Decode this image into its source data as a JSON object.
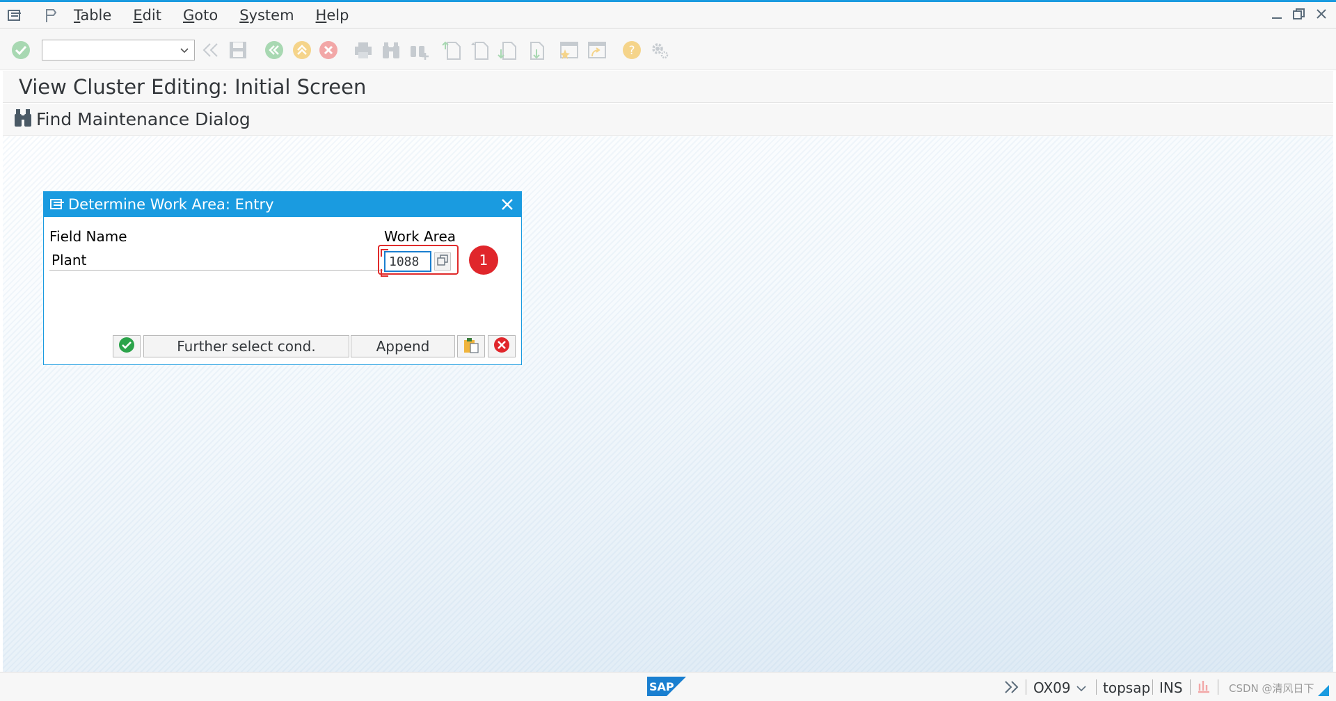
{
  "menu": {
    "items": [
      {
        "accel": "T",
        "rest": "able"
      },
      {
        "accel": "E",
        "rest": "dit"
      },
      {
        "accel": "G",
        "rest": "oto"
      },
      {
        "accel": "S",
        "rest": "ystem"
      },
      {
        "accel": "H",
        "rest": "elp"
      }
    ]
  },
  "toolbar": {
    "command_field_value": ""
  },
  "screen": {
    "title": "View Cluster Editing: Initial Screen",
    "app_button_label": "Find Maintenance Dialog"
  },
  "dialog": {
    "title": "Determine Work Area: Entry",
    "col_field_name": "Field Name",
    "col_work_area": "Work Area",
    "row_label": "Plant",
    "work_area_value": "1088",
    "annotation_number": "1",
    "buttons": {
      "further_select": "Further select cond.",
      "append": "Append"
    }
  },
  "statusbar": {
    "transaction": "OX09",
    "system": "topsap",
    "mode": "INS",
    "logo_text": "SAP",
    "watermark": "CSDN @清风日下"
  },
  "colors": {
    "accent": "#1a9be0",
    "highlight_red": "#e02b2b",
    "ok_green": "#2ba34a",
    "cancel_red": "#e0262b"
  }
}
